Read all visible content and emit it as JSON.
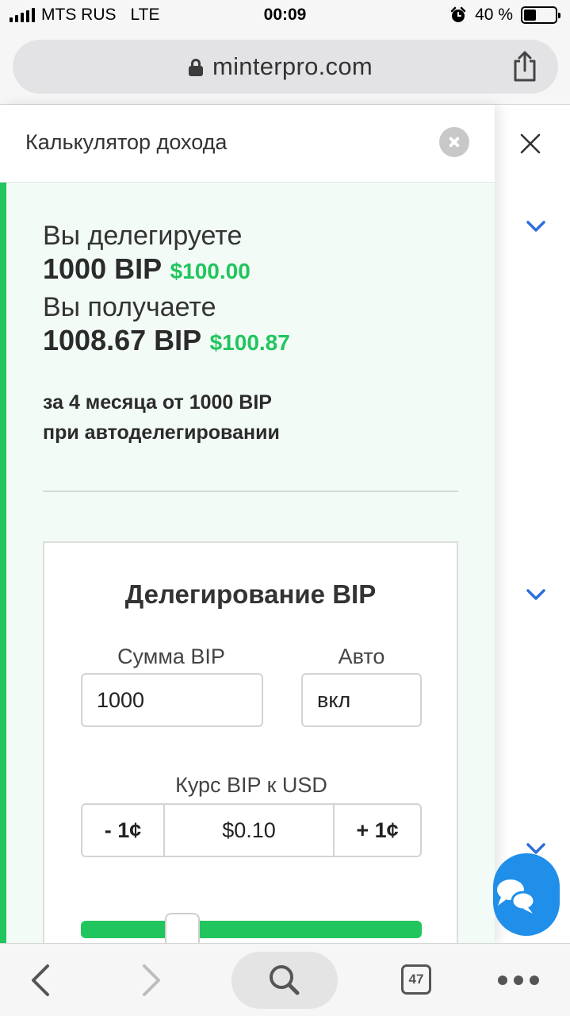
{
  "status_bar": {
    "carrier": "MTS RUS",
    "network": "LTE",
    "time": "00:09",
    "battery": "40 %",
    "battery_level": 0.4
  },
  "browser": {
    "url": "minterpro.com",
    "tab_count": "47"
  },
  "modal": {
    "title": "Калькулятор дохода",
    "delegate_label": "Вы делегируете",
    "delegate_amount": "1000 BIP",
    "delegate_usd": "$100.00",
    "receive_label": "Вы получаете",
    "receive_amount": "1008.67 BIP",
    "receive_usd": "$100.87",
    "note_line1": "за 4 месяца от 1000 BIP",
    "note_line2": "при автоделегировании"
  },
  "card": {
    "title": "Делегирование BIP",
    "amount_label": "Сумма BIP",
    "amount_value": "1000",
    "auto_label": "Авто",
    "auto_value": "вкл",
    "rate_label": "Курс BIP к USD",
    "rate_minus": "- 1¢",
    "rate_value": "$0.10",
    "rate_plus": "+ 1¢"
  },
  "colors": {
    "accent_green": "#22c55e",
    "panel_bg": "#f2fbf5",
    "chevron_blue": "#2f6fdb",
    "chat_blue": "#1f8fea"
  },
  "icons": [
    "lock-icon",
    "share-icon",
    "close-icon",
    "chevron-down-icon",
    "chat-icon",
    "back-icon",
    "forward-icon",
    "search-icon",
    "tabs-icon",
    "more-icon"
  ]
}
